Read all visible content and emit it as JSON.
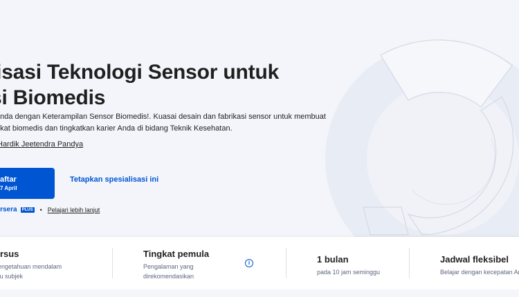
{
  "hero": {
    "title_line1": "lisasi Teknologi Sensor untuk",
    "title_line2": "si Biomedis",
    "description_line1": "anda dengan Keterampilan Sensor Biomedis!. Kuasai desain dan fabrikasi sensor untuk membuat",
    "description_line2": "gkat biomedis dan tingkatkan karier Anda di bidang Teknik Kesehatan.",
    "instructor": "Hardik Jeetendra Pandya",
    "enroll_label": "aftar",
    "enroll_sub": "7 April",
    "set_specialization": "Tetapkan spesialisasi ini",
    "plus_logo": "ursera",
    "plus_badge": "PLUS",
    "plus_dot": "•",
    "learn_more": "Pelajari lebih lanjut"
  },
  "info": {
    "item1": {
      "heading": "ursus",
      "sub_line1": "pengetahuan mendalam",
      "sub_line2": "atu subjek"
    },
    "item2": {
      "heading": "Tingkat pemula",
      "sub_line1": "Pengalaman yang",
      "sub_line2": "direkomendasikan",
      "info_icon": "i"
    },
    "item3": {
      "heading": "1 bulan",
      "sub_line1": "pada 10 jam seminggu"
    },
    "item4": {
      "heading": "Jadwal fleksibel",
      "sub_line1": "Belajar dengan kecepatan Anda"
    }
  },
  "colors": {
    "accent": "#0056d2",
    "hero_bg": "#f3f5fa",
    "text": "#1f1f1f",
    "muted": "#5b6780"
  },
  "icons": {
    "info": "info-circle-icon",
    "hero_art": "sensor-arc-illustration"
  }
}
